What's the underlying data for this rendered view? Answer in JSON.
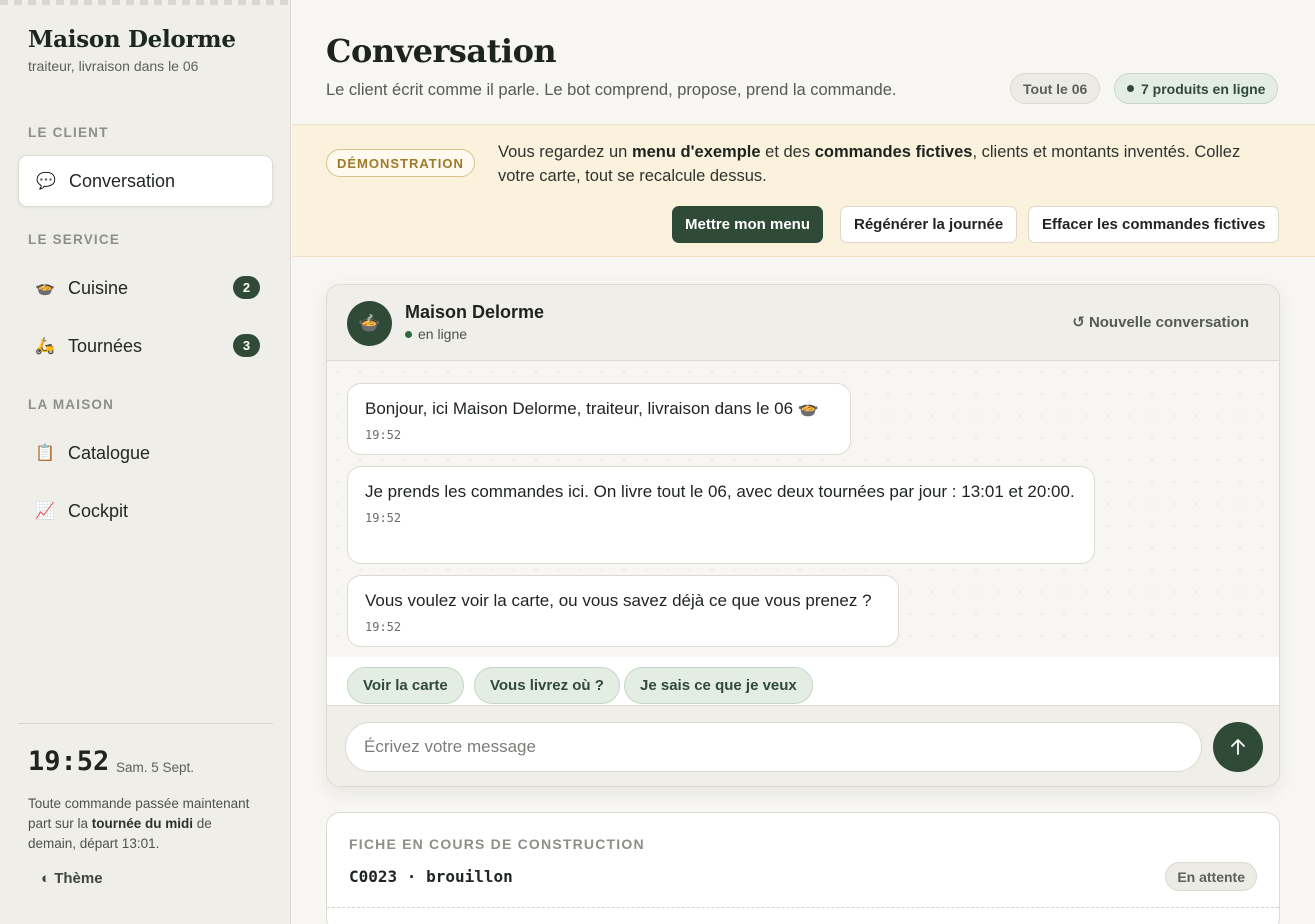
{
  "sidebar": {
    "brand": "Maison Delorme",
    "tagline": "traiteur, livraison dans le 06",
    "sections": {
      "client": "LE CLIENT",
      "service": "LE SERVICE",
      "maison": "LA MAISON"
    },
    "items": [
      {
        "label": "Conversation",
        "icon": "speech-bubble-icon",
        "glyph": "💬"
      },
      {
        "label": "Cuisine",
        "icon": "bowl-icon",
        "glyph": "🍲",
        "badge": "2"
      },
      {
        "label": "Tournées",
        "icon": "scooter-icon",
        "glyph": "🛵",
        "badge": "3"
      },
      {
        "label": "Catalogue",
        "icon": "clipboard-icon",
        "glyph": "📋"
      },
      {
        "label": "Cockpit",
        "icon": "chart-icon",
        "glyph": "📈"
      }
    ],
    "clock": {
      "time": "19:52",
      "date": "Sam. 5 Sept.",
      "note_start": "Toute commande passée maintenant part sur la ",
      "note_bold": "tournée du midi",
      "note_end": " de demain, départ 13:01."
    },
    "theme_label": "Thème"
  },
  "header": {
    "title": "Conversation",
    "subtitle": "Le client écrit comme il parle. Le bot comprend, propose, prend la commande.",
    "pill_zone": "Tout le 06",
    "pill_products": "7 produits en ligne"
  },
  "demo": {
    "tag": "DÉMONSTRATION",
    "text_1": "Vous regardez un ",
    "bold_1": "menu d'exemple",
    "text_2": " et des ",
    "bold_2": "commandes fictives",
    "text_3": ", clients et montants inventés. Collez votre carte, tout se recalcule dessus.",
    "btn_menu": "Mettre mon menu",
    "btn_regen": "Régénérer la journée",
    "btn_clear": "Effacer les commandes fictives"
  },
  "chat": {
    "name": "Maison Delorme",
    "status": "en ligne",
    "new_conversation": "↺ Nouvelle conversation",
    "messages": [
      {
        "text": "Bonjour, ici Maison Delorme, traiteur, livraison dans le 06 🍲",
        "time": "19:52"
      },
      {
        "text": "Je prends les commandes ici. On livre tout le 06, avec deux tournées par jour : 13:01 et 20:00.",
        "time": "19:52"
      },
      {
        "text": "Vous voulez voir la carte, ou vous savez déjà ce que vous prenez ?",
        "time": "19:52"
      }
    ],
    "chips": [
      "Voir la carte",
      "Vous livrez où ?",
      "Je sais ce que je veux"
    ],
    "input_placeholder": "Écrivez votre message"
  },
  "sheet": {
    "title": "FICHE EN COURS DE CONSTRUCTION",
    "order_id": "C0023 · brouillon",
    "status": "En attente"
  }
}
